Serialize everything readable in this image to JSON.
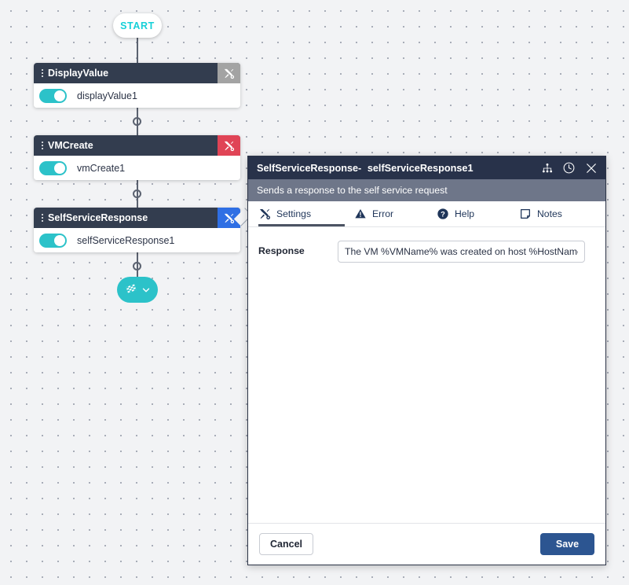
{
  "canvas": {
    "start_node": {
      "label": "START",
      "icon": "start-pill"
    },
    "end_node": {
      "icon": "checkered-flag-icon",
      "chevron": "chevron-down-icon"
    },
    "nodes": [
      {
        "title": "DisplayValue",
        "instance": "displayValue1",
        "tool_icon": "tools-icon",
        "tool_color": "#a3a3a3",
        "enabled": true
      },
      {
        "title": "VMCreate",
        "instance": "vmCreate1",
        "tool_icon": "tools-icon",
        "tool_color": "#e04456",
        "enabled": true
      },
      {
        "title": "SelfServiceResponse",
        "instance": "selfServiceResponse1",
        "tool_icon": "tools-icon",
        "tool_color": "#2f6fe4",
        "enabled": true
      }
    ]
  },
  "panel": {
    "title_type": "SelfServiceResponse-",
    "title_instance": "selfServiceResponse1",
    "subtitle": "Sends a response to the self service request",
    "header_icons": [
      {
        "name": "hierarchy-icon"
      },
      {
        "name": "clock-icon"
      },
      {
        "name": "close-icon"
      }
    ],
    "tabs": [
      {
        "label": "Settings",
        "icon": "tools-icon",
        "active": true
      },
      {
        "label": "Error",
        "icon": "warning-triangle-icon",
        "active": false
      },
      {
        "label": "Help",
        "icon": "question-circle-icon",
        "active": false
      },
      {
        "label": "Notes",
        "icon": "note-icon",
        "active": false
      }
    ],
    "fields": [
      {
        "label": "Response",
        "value": "The VM %VMName% was created on host %HostName% with datastore %DatastoreName%",
        "placeholder": ""
      }
    ],
    "footer": {
      "cancel_label": "Cancel",
      "save_label": "Save"
    }
  },
  "colors": {
    "accent_teal": "#2cc2c9",
    "start_cyan": "#16d0d8",
    "node_header": "#333d4f",
    "panel_header": "#28324a",
    "panel_subheader": "#6e7689",
    "save_blue": "#2c5591",
    "error_red": "#e04456",
    "selected_blue": "#2f6fe4",
    "canvas_bg": "#f2f3f5"
  }
}
